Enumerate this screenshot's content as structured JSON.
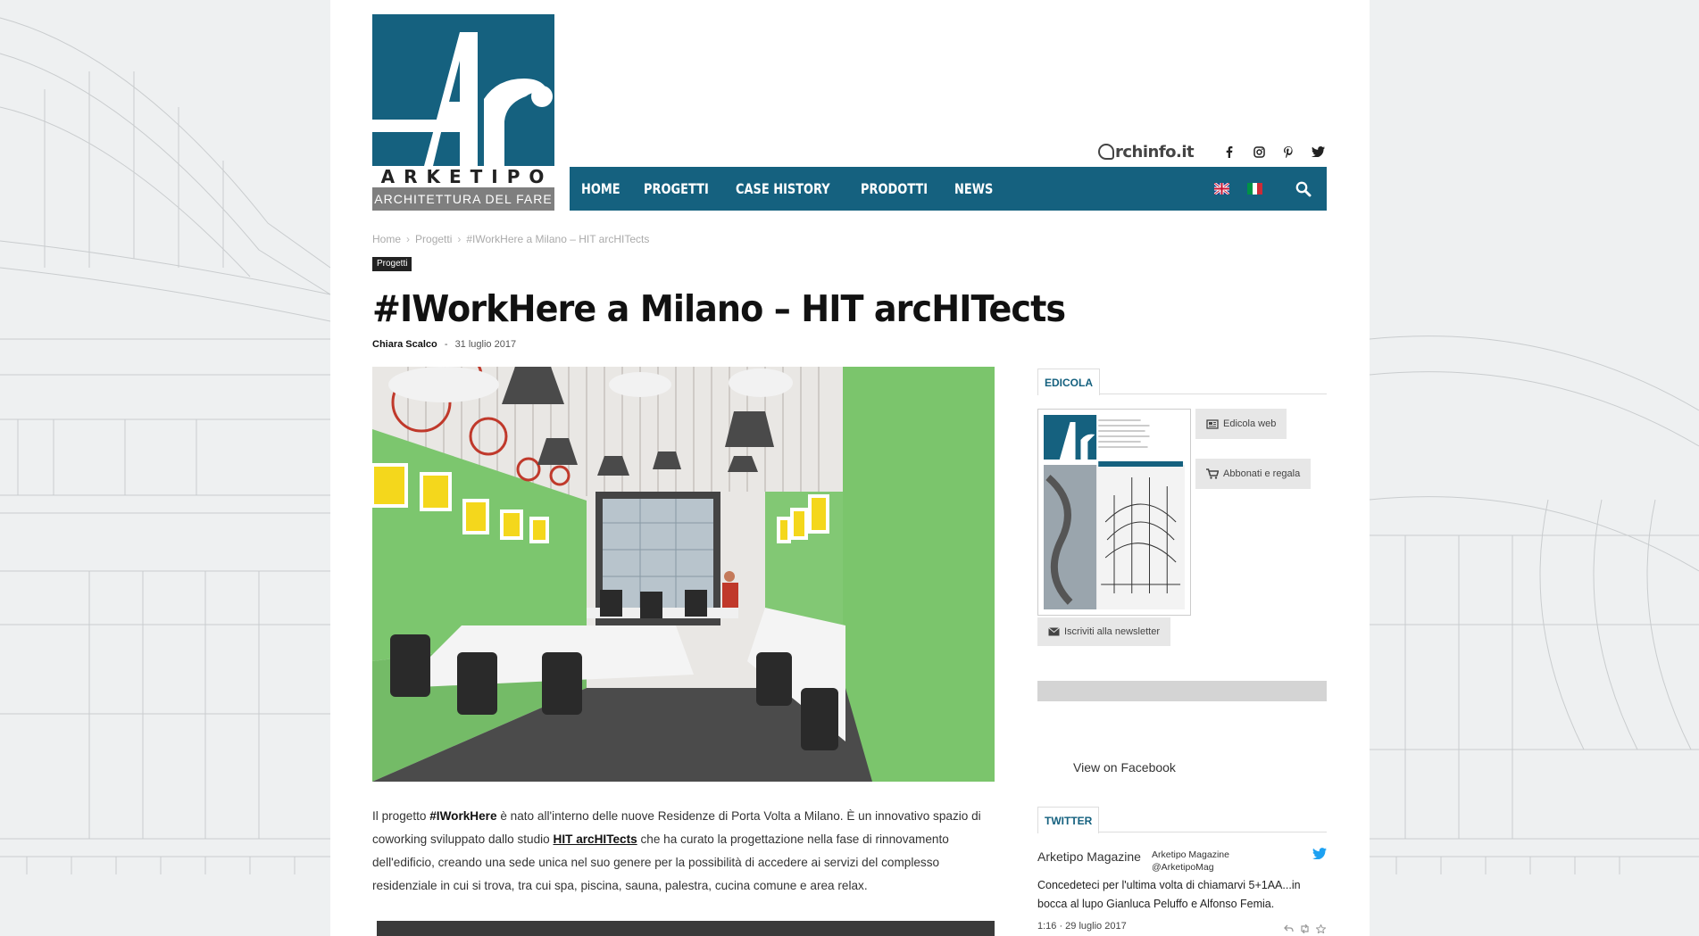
{
  "header": {
    "logo_name": "ARKETIPO",
    "logo_tagline": "ARCHITETTURA DEL FARE",
    "archinfo_label": "rchinfo.it",
    "socials": [
      "facebook-icon",
      "instagram-icon",
      "pinterest-icon",
      "twitter-icon"
    ]
  },
  "nav": {
    "items": [
      "HOME",
      "PROGETTI",
      "CASE HISTORY",
      "PRODOTTI",
      "NEWS"
    ],
    "languages": [
      "uk-flag-icon",
      "italy-flag-icon"
    ]
  },
  "breadcrumb": [
    "Home",
    "Progetti",
    "#IWorkHere a Milano – HIT arcHITects"
  ],
  "article": {
    "category": "Progetti",
    "title": "#IWorkHere a Milano – HIT arcHITects",
    "author": "Chiara Scalco",
    "separator": "-",
    "date": "31 luglio 2017",
    "p1_a": "Il progetto ",
    "p1_b": "#IWorkHere",
    "p1_c": " è nato all'interno delle nuove Residenze di Porta Volta a Milano. È un innovativo spazio di coworking sviluppato dallo studio ",
    "p1_d": "HIT arcHITects",
    "p1_e": " che ha curato la progettazione nella fase di rinnovamento dell'edificio, creando una sede unica nel suo genere per la possibilità di accedere ai servizi del complesso residenziale in cui si trova, tra cui spa, piscina, sauna, palestra, cucina comune e area relax."
  },
  "sidebar": {
    "edicola_title": "EDICOLA",
    "edicola_web": "Edicola web",
    "abbonati": "Abbonati e regala",
    "newsletter": "Iscriviti alla newsletter",
    "facebook_link": "View on Facebook",
    "twitter_title": "TWITTER",
    "tweet_name": "Arketipo Magazine",
    "tweet_display_name": "Arketipo Magazine",
    "tweet_handle": "@ArketipoMag",
    "tweet_text": "Concedeteci per l'ultima volta di chiamarvi 5+1AA...in bocca al lupo Gianluca Peluffo e Alfonso Femia.",
    "tweet_time": "1:16 · 29 luglio 2017"
  },
  "colors": {
    "brand": "#15617f",
    "green_wall": "#7cc66e",
    "yellow": "#f4d71c"
  }
}
